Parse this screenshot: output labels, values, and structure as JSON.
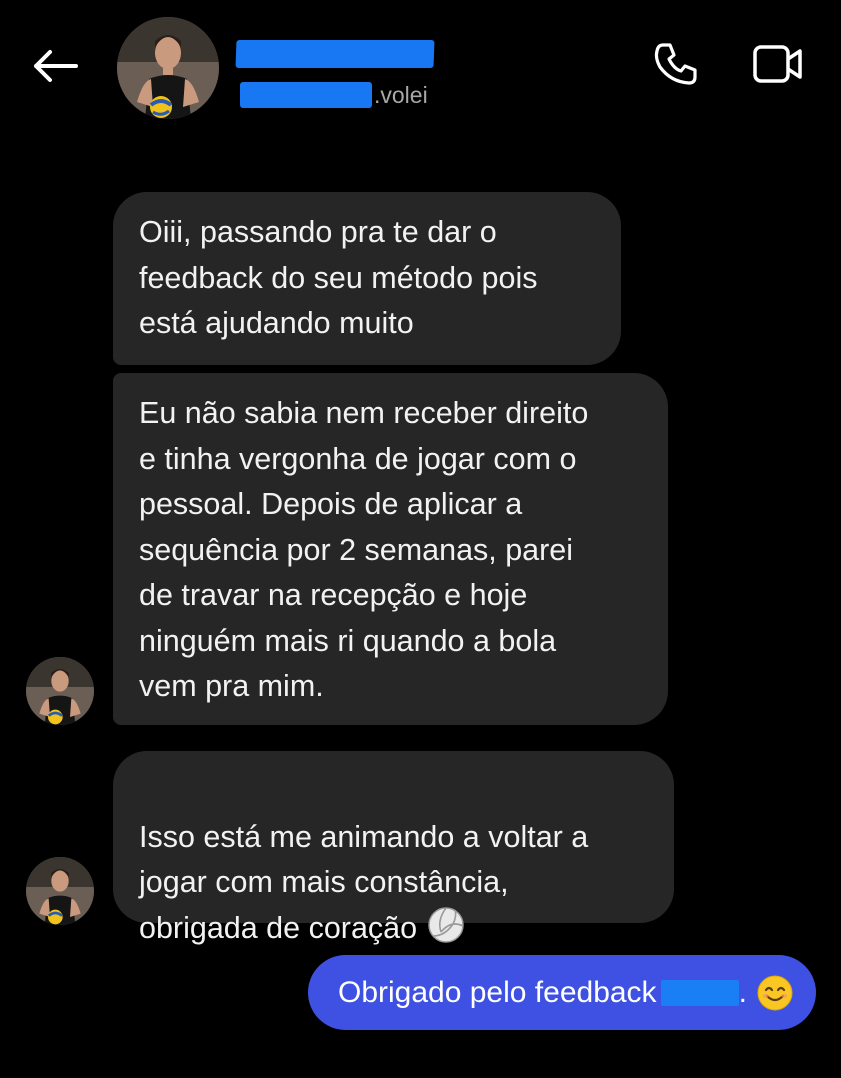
{
  "header": {
    "back_icon": "arrow-left-icon",
    "contact_username_suffix": ".volei",
    "call_icon": "phone-icon",
    "video_icon": "video-camera-icon"
  },
  "messages": [
    {
      "direction": "received",
      "text": "Oiii, passando pra te dar o\nfeedback do seu método pois\nestá ajudando muito"
    },
    {
      "direction": "received",
      "text": "Eu não sabia nem receber direito\ne tinha vergonha de jogar com o\npessoal. Depois de aplicar a\nsequência por 2 semanas, parei\nde travar na recepção e hoje\nninguém mais ri quando a bola\nvem pra mim."
    },
    {
      "direction": "received",
      "text": "Isso está me animando a voltar a\njogar com mais constância,\nobrigada de coração",
      "trailing_icon": "volleyball-icon"
    },
    {
      "direction": "sent",
      "text_before": "Obrigado pelo feedback",
      "text_after": ".",
      "trailing_icon": "smiling-face-icon"
    }
  ],
  "colors": {
    "background": "#000000",
    "received_bubble": "#262626",
    "sent_bubble": "#3e51e3",
    "redaction": "#1877f2"
  }
}
